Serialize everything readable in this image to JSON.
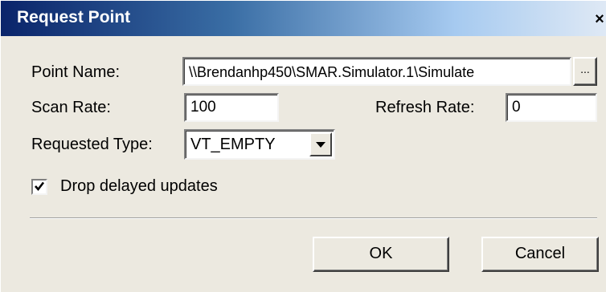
{
  "window": {
    "title": "Request Point",
    "close_glyph": "×"
  },
  "form": {
    "point_name_label": "Point Name:",
    "point_name_value": "\\\\Brendanhp450\\SMAR.Simulator.1\\Simulate",
    "browse_label": "...",
    "scan_rate_label": "Scan Rate:",
    "scan_rate_value": "100",
    "refresh_rate_label": "Refresh Rate:",
    "refresh_rate_value": "0",
    "requested_type_label": "Requested Type:",
    "requested_type_value": "VT_EMPTY",
    "drop_delayed_label": "Drop delayed updates",
    "drop_delayed_checked": true
  },
  "buttons": {
    "ok_label": "OK",
    "cancel_label": "Cancel"
  },
  "icons": {
    "close": "close-icon",
    "dropdown": "chevron-down-icon",
    "check": "checkmark-icon"
  }
}
